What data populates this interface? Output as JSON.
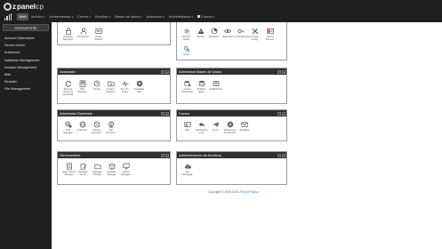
{
  "app": {
    "logo_z": "z",
    "logo_panel": "panel",
    "logo_cp": "cp"
  },
  "topmenu": [
    {
      "label": "Web",
      "active": true,
      "caret": false
    },
    {
      "label": "Archivo",
      "caret": true
    },
    {
      "label": "Herramientas",
      "caret": true
    },
    {
      "label": "Correo",
      "caret": true
    },
    {
      "label": "Servidor",
      "caret": true
    },
    {
      "label": "Bases de datos",
      "caret": true
    },
    {
      "label": "Avanzado",
      "caret": true
    },
    {
      "label": "Administrador",
      "caret": true
    },
    {
      "label": "Cuenta",
      "caret": true,
      "square": true
    }
  ],
  "sidebar": {
    "header": "Account Info",
    "items": [
      "Account Information",
      "Server Admin",
      "Advanced",
      "Database Management",
      "Domain Management",
      "Mail",
      "Reseller",
      "File Management"
    ]
  },
  "panels": {
    "top_left": {
      "items": [
        "Chequeo Dispuesto",
        "Mi Account",
        "Usage Manuel"
      ]
    },
    "top_right": {
      "items": [
        "Servicio Cache",
        "Alertas",
        "Aplicacion",
        "Seguridad",
        "Lenovocaciones",
        "Control Config",
        "cPanel Servers"
      ],
      "extra": "Activo"
    },
    "avanzado": {
      "title": "Avanzado",
      "items": [
        "Tarea de copias de seguridad",
        "CPU Manager",
        "Tienda",
        "Protect Directory",
        "Sec. No. Status",
        "Instalador Web"
      ]
    },
    "bases": {
      "title": "Administar Bases de Datos",
      "items": [
        "Acceso Databases",
        "Mi Base Datos",
        "phpMyAdmin"
      ]
    },
    "dominios": {
      "title": "Administar Dominios",
      "items": [
        "DNS Manager",
        "Dominios",
        "Parked Domains",
        "Sub Domains"
      ]
    },
    "correo": {
      "title": "Correo",
      "items": [
        "Mail",
        "Calcificacion Lista",
        "Envio",
        "Referencia del Dominio",
        "SendMail"
      ]
    },
    "generadores": {
      "title": "Generadores",
      "items": [
        "Index Library Manager",
        "Manager Server",
        "Manager Domain",
        "Package Manager",
        "Online Manager"
      ]
    },
    "archivos": {
      "title": "Administracion de Archivos",
      "items": [
        "Tus descargas"
      ]
    }
  },
  "footer": {
    "prefix": "Copyright © 2009-2015 ",
    "link": "ZPanel Project"
  },
  "colors": {
    "chrome": "#1f1f1f",
    "panel_header": "#2f2f2f",
    "accent_link": "#3a7bd5"
  }
}
